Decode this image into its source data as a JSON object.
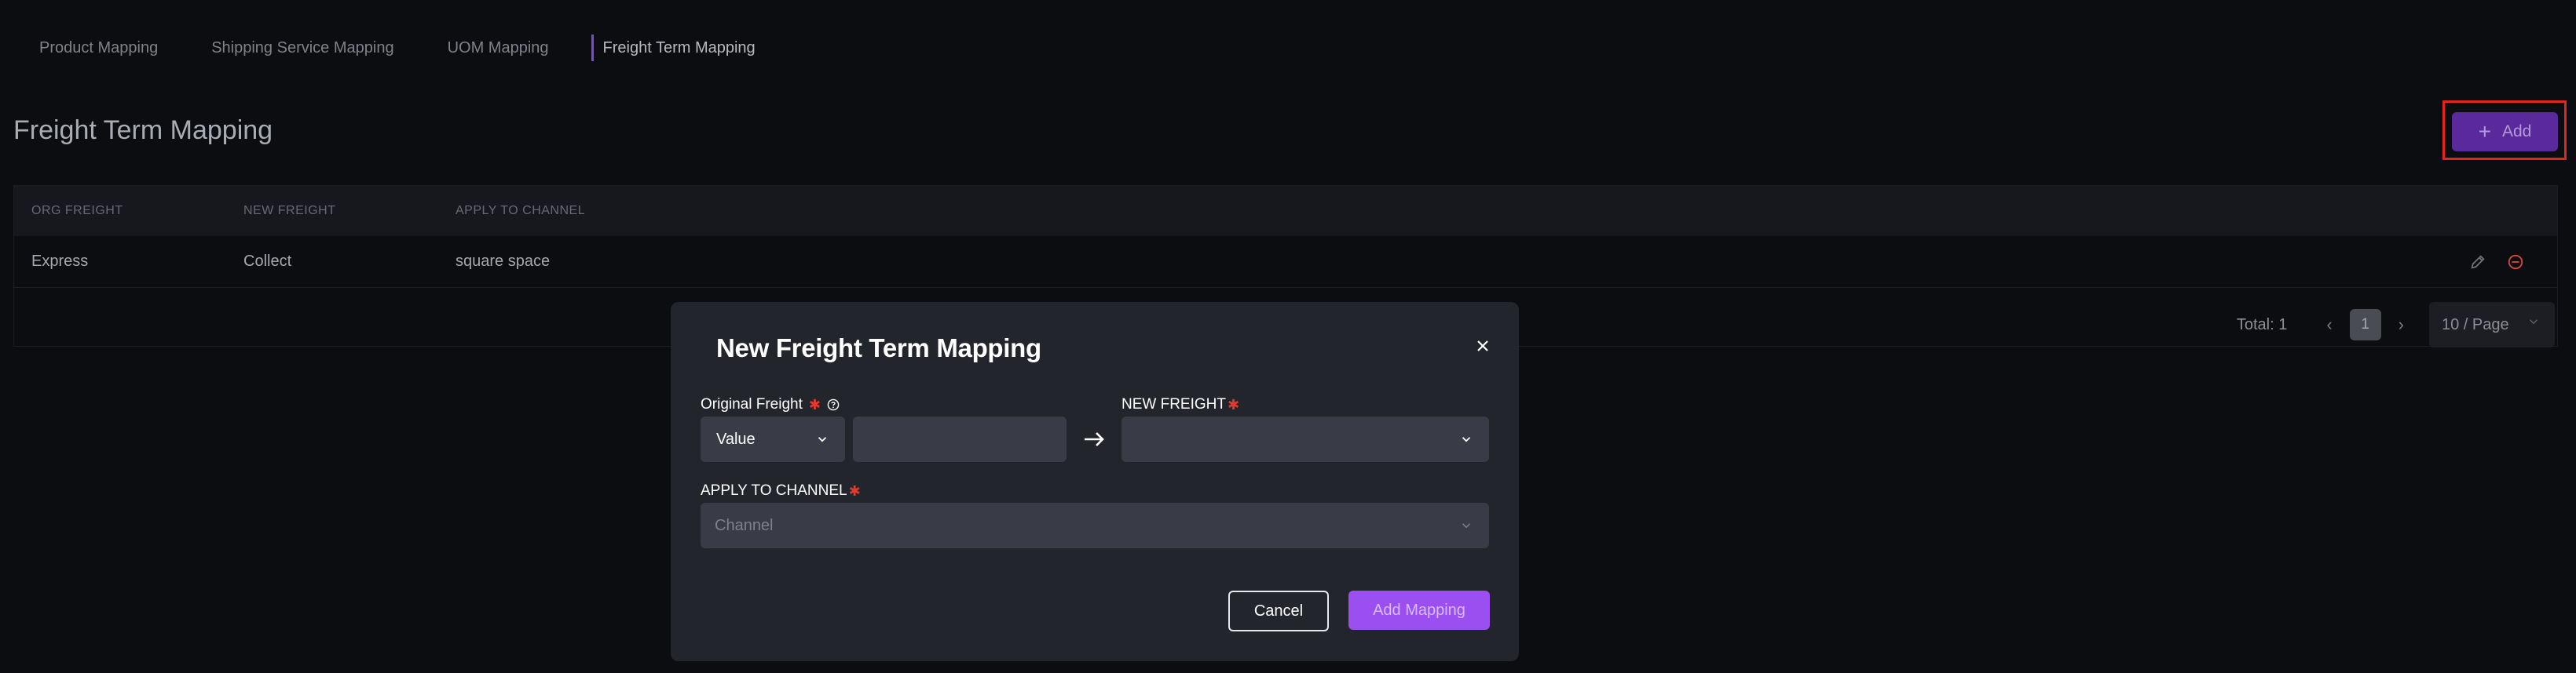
{
  "tabs": [
    {
      "label": "Product Mapping"
    },
    {
      "label": "Shipping Service Mapping"
    },
    {
      "label": "UOM Mapping"
    },
    {
      "label": "Freight Term Mapping",
      "active": true
    }
  ],
  "page_title": "Freight Term Mapping",
  "add_button": {
    "label": "Add",
    "icon": "plus-icon"
  },
  "table": {
    "columns": [
      "ORG FREIGHT",
      "NEW FREIGHT",
      "APPLY TO CHANNEL"
    ],
    "rows": [
      {
        "org_freight": "Express",
        "new_freight": "Collect",
        "channel": "square space"
      }
    ]
  },
  "pagination": {
    "total": "Total: 1",
    "current_page": "1",
    "per_page": "10 / Page"
  },
  "modal": {
    "title": "New Freight Term Mapping",
    "original_freight_label": "Original Freight",
    "original_freight_type": "Value",
    "original_freight_value": "",
    "new_freight_label": "NEW FREIGHT",
    "new_freight_value": "",
    "channel_label": "APPLY TO CHANNEL",
    "channel_placeholder": "Channel",
    "cancel_label": "Cancel",
    "submit_label": "Add Mapping"
  },
  "colors": {
    "background": "#0c0d10",
    "accent": "#9b4ff0",
    "add_button": "#5a2a9c",
    "required": "#e5392f",
    "highlight_box": "#e0271d",
    "delete_icon": "#d24b3e"
  }
}
